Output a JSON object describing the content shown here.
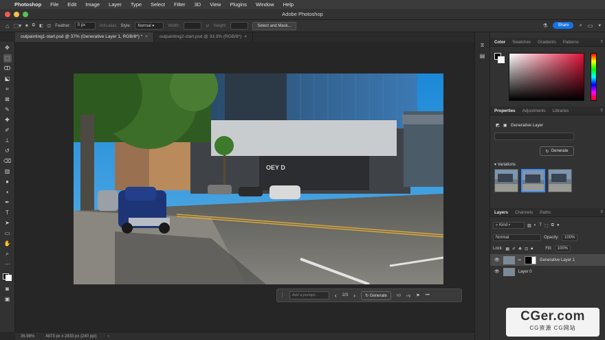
{
  "menubar": {
    "apple": "",
    "app_name": "Photoshop",
    "items": [
      "File",
      "Edit",
      "Image",
      "Layer",
      "Type",
      "Select",
      "Filter",
      "3D",
      "View",
      "Plugins",
      "Window",
      "Help"
    ]
  },
  "window": {
    "title": "Adobe Photoshop"
  },
  "options_bar": {
    "feather_label": "Feather:",
    "feather_value": "0 px",
    "antialias_label": "Anti-alias",
    "style_label": "Style:",
    "style_value": "Normal",
    "width_label": "Width:",
    "height_label": "Height:",
    "select_mask_label": "Select and Mask...",
    "share_label": "Share"
  },
  "tabs": [
    {
      "label": "outpainting1-start.psd @ 37% (Generative Layer 1, RGB/8*) *",
      "close": "×"
    },
    {
      "label": "outpainting2-start.psd @ 33.3% (RGB/8*)",
      "close": "×"
    }
  ],
  "context_bar": {
    "prompt_placeholder": "Add a prompt...",
    "counter": "2/3",
    "generate_label": "Generate",
    "prev": "‹",
    "next": "›",
    "more": "•••"
  },
  "status_bar": {
    "zoom": "36.98%",
    "doc_info": "4873 px x 2833 px (240 ppi)",
    "arrow": "›"
  },
  "color_panel": {
    "tabs": [
      "Color",
      "Swatches",
      "Gradients",
      "Patterns"
    ],
    "accent_color": "#e01238"
  },
  "properties_panel": {
    "tabs": [
      "Properties",
      "Adjustments",
      "Libraries"
    ],
    "layer_name": "Generative Layer",
    "generate_label": "Generate",
    "variations_label": "Variations"
  },
  "layers_panel": {
    "tabs": [
      "Layers",
      "Channels",
      "Paths"
    ],
    "kind_label": "Kind",
    "blend_mode": "Normal",
    "opacity_label": "Opacity:",
    "opacity_value": "100%",
    "lock_label": "Lock:",
    "fill_label": "Fill:",
    "fill_value": "100%",
    "layers": [
      {
        "name": "Generative Layer 1",
        "selected": true
      },
      {
        "name": "Layer 0",
        "selected": false
      }
    ]
  },
  "watermark": {
    "main": "CGer.com",
    "sub": "CG资源 CG网站"
  },
  "image_text": {
    "storefront_sign": "OEY D"
  }
}
